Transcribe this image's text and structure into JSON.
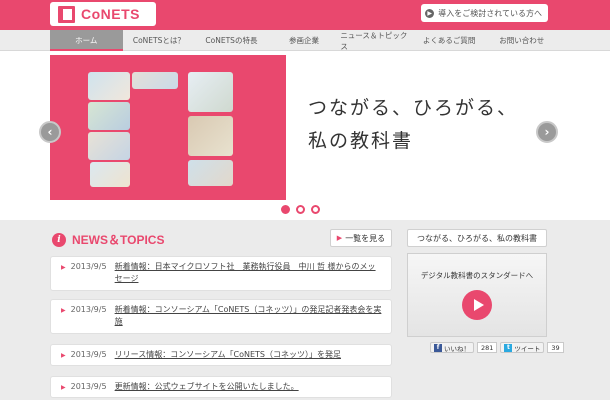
{
  "header": {
    "logo_text": "CoNETS",
    "intro_link": "導入をご検討されている方へ"
  },
  "nav": {
    "items": [
      {
        "label": "ホーム"
      },
      {
        "label": "CoNETSとは？"
      },
      {
        "label": "CoNETSの特長"
      },
      {
        "label": "参画企業"
      },
      {
        "label": "ニュース＆トピックス"
      },
      {
        "label": "よくあるご質問"
      },
      {
        "label": "お問い合わせ"
      }
    ]
  },
  "hero": {
    "copy_line1": "つながる、ひろがる、",
    "copy_line2": "私の教科書",
    "prev_glyph": "‹",
    "next_glyph": "›"
  },
  "news": {
    "title": "NEWS＆TOPICS",
    "more_label": "一覧を見る",
    "items": [
      {
        "date": "2013/9/5",
        "text": "新着情報：日本マイクロソフト社　業務執行役員　中川 哲 様からのメッセージ"
      },
      {
        "date": "2013/9/5",
        "text": "新着情報：コンソーシアム「CoNETS（コネッツ）」の発足記者発表会を実施"
      },
      {
        "date": "2013/9/5",
        "text": "リリース情報：コンソーシアム「CoNETS（コネッツ）」を発足"
      },
      {
        "date": "2013/9/5",
        "text": "更新情報：公式ウェブサイトを公開いたしました。"
      }
    ]
  },
  "sidebar": {
    "tab_label": "つながる、ひろがる、私の教科書",
    "video_title": "デジタル教科書のスタンダードへ",
    "like_label": "いいね！",
    "like_count": "281",
    "tweet_label": "ツイート",
    "tweet_count": "39"
  },
  "colors": {
    "brand": "#e9486e",
    "nav_bg": "#ececec",
    "panel_bg": "#ebebeb"
  }
}
